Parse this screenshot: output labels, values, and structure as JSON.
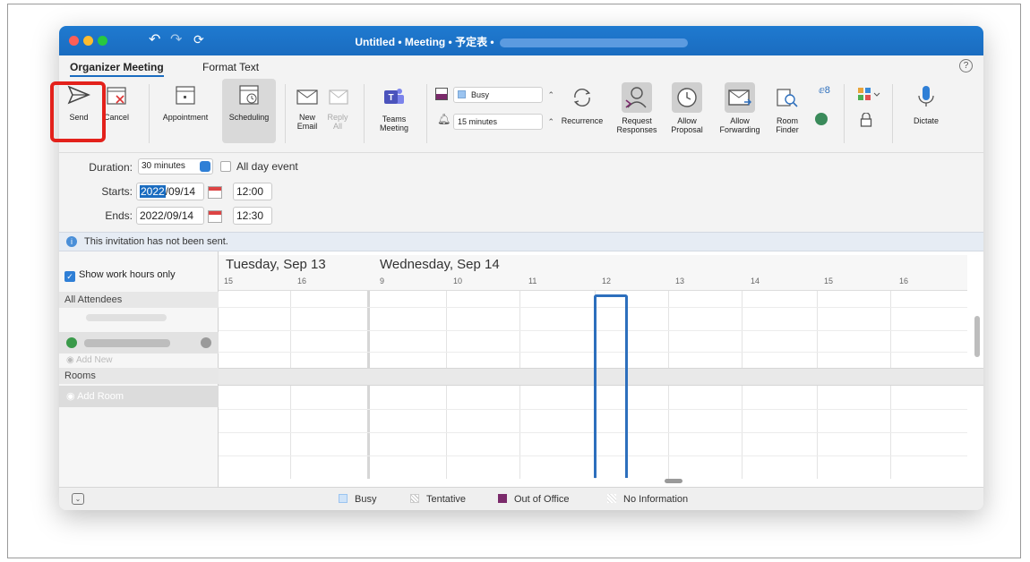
{
  "window": {
    "title": "Untitled • Meeting • 予定表 •"
  },
  "tabs": {
    "organizer": "Organizer Meeting",
    "format": "Format Text",
    "help": "?"
  },
  "ribbon": {
    "send": "Send",
    "cancel": "Cancel",
    "appointment": "Appointment",
    "scheduling": "Scheduling",
    "new_email_1": "New",
    "new_email_2": "Email",
    "reply_all_1": "Reply",
    "reply_all_2": "All",
    "teams_1": "Teams",
    "teams_2": "Meeting",
    "show_as": "Busy",
    "reminder": "15 minutes",
    "recurrence": "Recurrence",
    "request_1": "Request",
    "request_2": "Responses",
    "allow_proposal_1": "Allow",
    "allow_proposal_2": "Proposal",
    "allow_fwd_1": "Allow",
    "allow_fwd_2": "Forwarding",
    "room_finder_1": "Room",
    "room_finder_2": "Finder",
    "dictate": "Dictate"
  },
  "form": {
    "duration_label": "Duration:",
    "duration_value": "30 minutes",
    "all_day_label": "All day event",
    "starts_label": "Starts:",
    "start_year": "2022",
    "start_date_rest": "/09/14",
    "start_time": "12:00",
    "ends_label": "Ends:",
    "end_date": "2022/09/14",
    "end_time": "12:30"
  },
  "info": {
    "message": "This invitation has not been sent."
  },
  "schedule": {
    "show_work_hours": "Show work hours only",
    "all_attendees": "All Attendees",
    "add_new": "Add New",
    "rooms": "Rooms",
    "add_room": "Add Room",
    "day1": "Tuesday, Sep 13",
    "day2": "Wednesday, Sep 14",
    "hours_day1": [
      "15",
      "16"
    ],
    "hours_day2": [
      "9",
      "10",
      "11",
      "12",
      "13",
      "14",
      "15",
      "16"
    ]
  },
  "legend": {
    "busy": "Busy",
    "tentative": "Tentative",
    "out_of_office": "Out of Office",
    "no_info": "No Information"
  },
  "colors": {
    "titlebar": "#1a6cc0",
    "highlight": "#e3211b",
    "meeting_outline": "#2d6fbd",
    "out_of_office": "#7b2a6b",
    "busy": "#9bc4f0"
  }
}
